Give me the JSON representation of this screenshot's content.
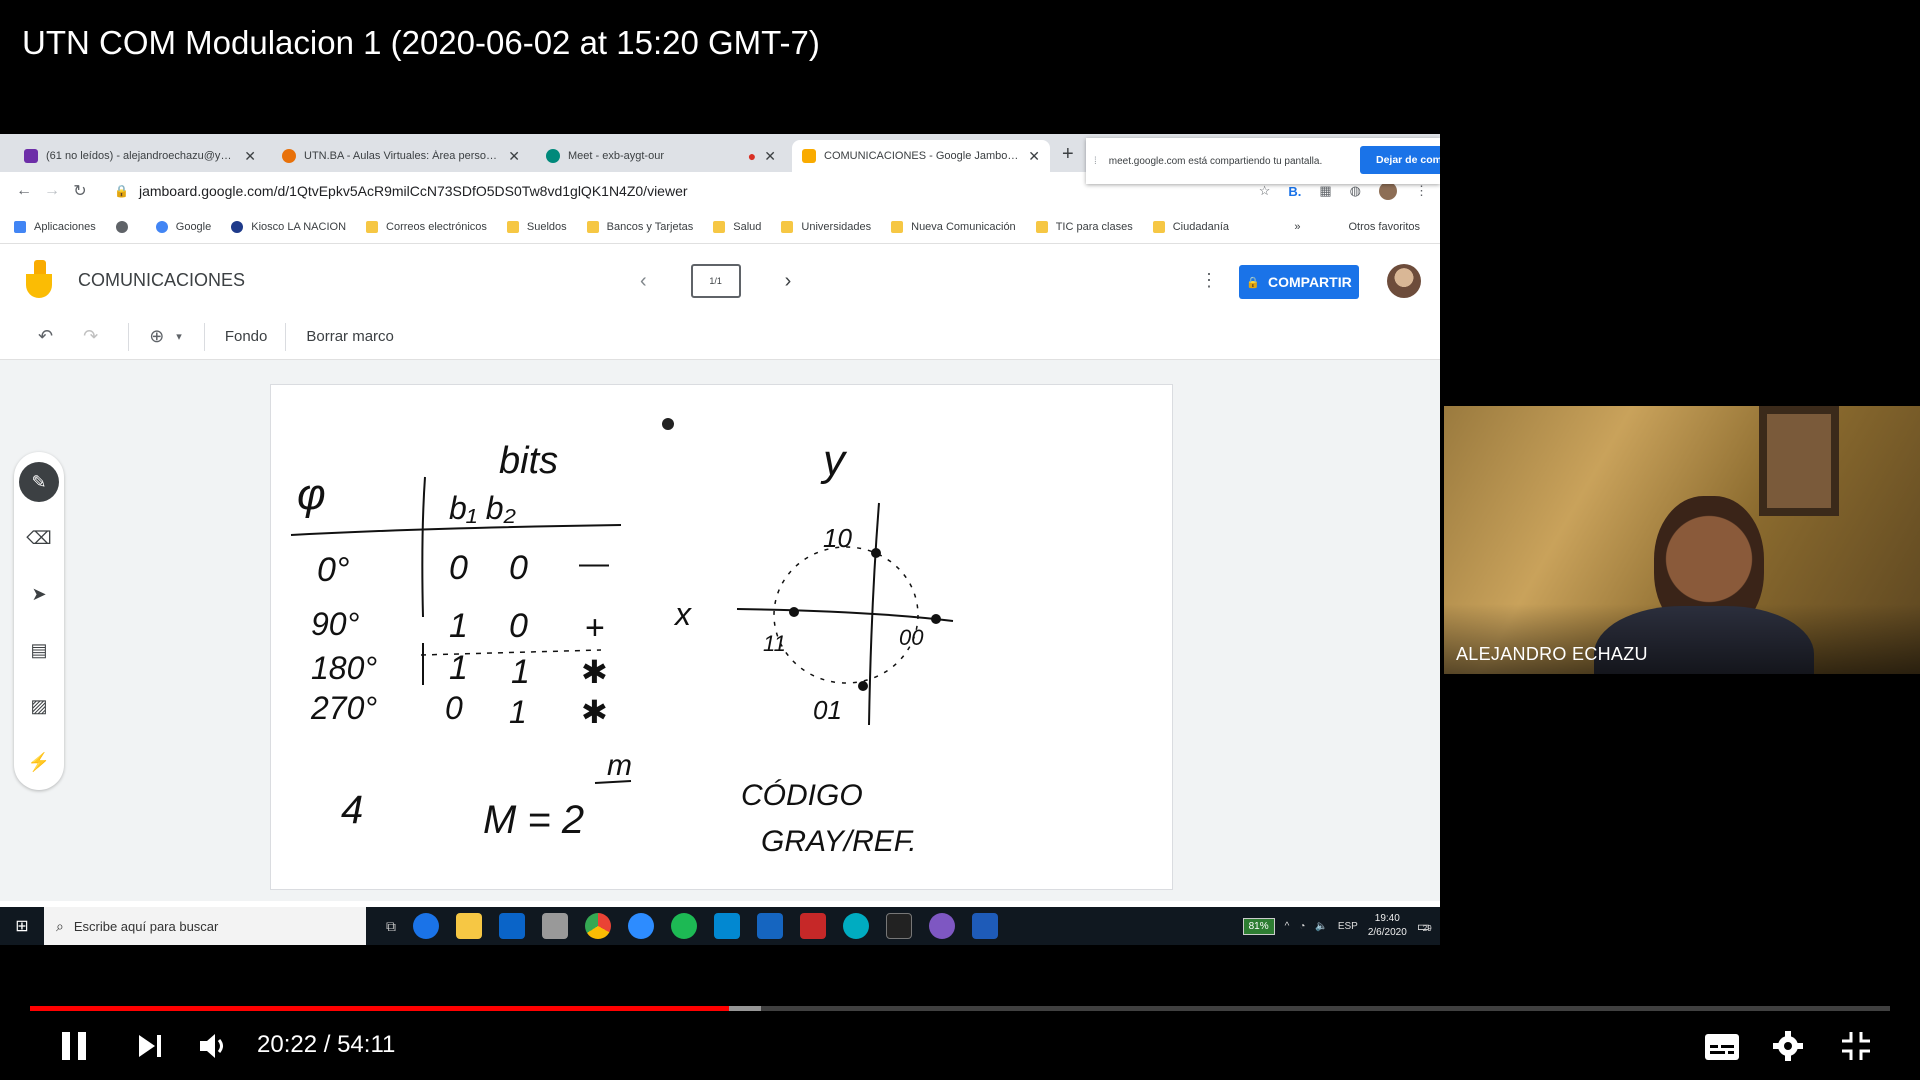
{
  "video": {
    "title": "UTN COM Modulacion 1 (2020-06-02 at 15:20 GMT-7)",
    "time_current": "20:22",
    "time_total": "54:11",
    "progress_fraction": 0.376,
    "buffered_fraction": 0.393
  },
  "browser": {
    "tabs": [
      {
        "label": "(61 no leídos) - alejandroechazu@yahoo",
        "color": "#6d2ea8",
        "active": false
      },
      {
        "label": "UTN.BA - Aulas Virtuales: Área personal",
        "color": "#e8710a",
        "active": false
      },
      {
        "label": "Meet - exb-aygt-our",
        "color": "#00897b",
        "active": false
      },
      {
        "label": "COMUNICACIONES - Google Jamboard",
        "color": "#f9ab00",
        "active": true
      }
    ],
    "share_notice": "meet.google.com está compartiendo tu pantalla.",
    "stop_share_label": "Dejar de compartir",
    "url": "jamboard.google.com/d/1QtvEpkv5AcR9milCcN73SDfO5DS0Tw8vd1glQK1N4Z0/viewer",
    "bookmarks": [
      {
        "label": "Aplicaciones",
        "color": "#4285f4"
      },
      {
        "label": "",
        "color": "#5f6368"
      },
      {
        "label": "Google",
        "color": "#4285f4"
      },
      {
        "label": "Kiosco LA NACION",
        "color": "#1e3a8a"
      },
      {
        "label": "Correos electrónicos",
        "color": "#f6c744"
      },
      {
        "label": "Sueldos",
        "color": "#f6c744"
      },
      {
        "label": "Bancos y Tarjetas",
        "color": "#f6c744"
      },
      {
        "label": "Salud",
        "color": "#f6c744"
      },
      {
        "label": "Universidades",
        "color": "#f6c744"
      },
      {
        "label": "Nueva Comunicación",
        "color": "#f6c744"
      },
      {
        "label": "TIC para clases",
        "color": "#f6c744"
      },
      {
        "label": "Ciudadanía",
        "color": "#f6c744"
      }
    ],
    "bookmarks_more": "»",
    "other_bookmarks": "Otros favoritos"
  },
  "jamboard": {
    "doc_title": "COMUNICACIONES",
    "frame_indicator": "1/1",
    "share_label": "COMPARTIR",
    "toolbar": {
      "background_label": "Fondo",
      "clear_label": "Borrar marco"
    }
  },
  "whiteboard": {
    "header_bits": "bits",
    "header_phi": "φ",
    "header_b1b2": "b₁ b₂",
    "rows": [
      {
        "phase": "0°",
        "b1": "0",
        "b2": "0",
        "sym": "—"
      },
      {
        "phase": "90°",
        "b1": "1",
        "b2": "0",
        "sym": "+"
      },
      {
        "phase": "180°",
        "b1": "1",
        "b2": "1",
        "sym": "✱"
      },
      {
        "phase": "270°",
        "b1": "0",
        "b2": "1",
        "sym": "✱"
      }
    ],
    "axis_y": "y",
    "axis_x": "x",
    "labels": {
      "top": "10",
      "left": "11",
      "right": "00",
      "bottom": "01"
    },
    "four": "4",
    "formula": "M = 2",
    "formula_exp": "m",
    "code_line1": "CÓDIGO",
    "code_line2": "GRAY/REF."
  },
  "taskbar": {
    "search_placeholder": "Escribe aquí para buscar",
    "battery": "81%",
    "lang": "ESP",
    "time": "19:40",
    "date": "2/6/2020",
    "notifications": "29"
  },
  "webcam": {
    "name": "ALEJANDRO ECHAZU"
  }
}
